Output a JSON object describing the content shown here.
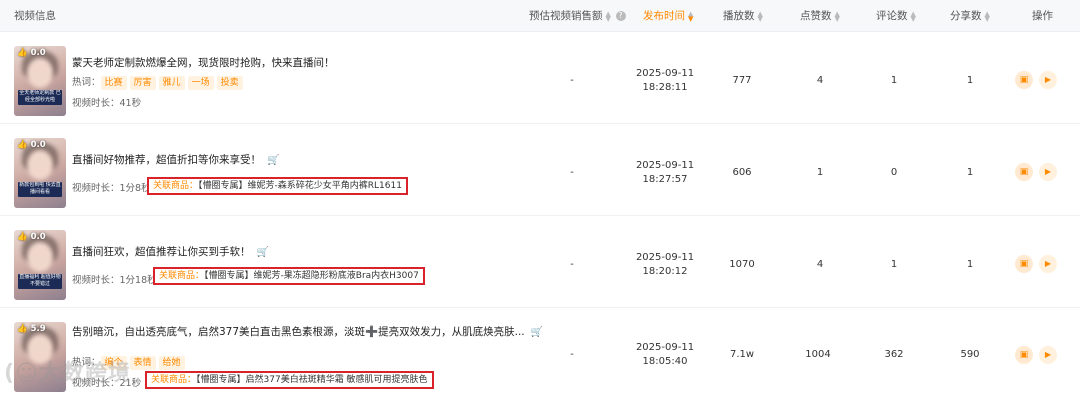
{
  "header": {
    "video_info": "视频信息",
    "est_sales": "预估视频销售额",
    "publish_time": "发布时间",
    "plays": "播放数",
    "likes": "点赞数",
    "comments": "评论数",
    "shares": "分享数",
    "actions": "操作"
  },
  "labels": {
    "hot_words": "热词：",
    "duration": "视频时长：",
    "related_product": "关联商品："
  },
  "rows": [
    {
      "score": "0.0",
      "thumb_caption": "全天老师定制款 已经全部秒光啦",
      "title": "蒙天老师定制款燃爆全网，现货限时抢购，快来直播间！",
      "tags": [
        "比赛",
        "厉害",
        "雅儿",
        "一场",
        "投卖"
      ],
      "duration": "41秒",
      "product": "",
      "est_sales": "-",
      "date": "2025-09-11",
      "time": "18:28:11",
      "plays": "777",
      "likes": "4",
      "comments": "1",
      "shares": "1"
    },
    {
      "score": "0.0",
      "thumb_caption": "新款包到啦 快去直播间看看",
      "title": "直播间好物推荐，超值折扣等你来享受！",
      "tags": [],
      "duration": "1分8秒",
      "product": "【懵圈专属】维妮芳-森系碎花少女平角内裤RL1611",
      "est_sales": "-",
      "date": "2025-09-11",
      "time": "18:27:57",
      "plays": "606",
      "likes": "1",
      "comments": "0",
      "shares": "1"
    },
    {
      "score": "0.0",
      "thumb_caption": "直播福利 超值好物不要错过",
      "title": "直播间狂欢，超值推荐让你买到手软！",
      "tags": [],
      "duration": "1分18秒",
      "product": "【懵圈专属】维妮芳-果冻超隐形粉底液Bra内衣H3007",
      "est_sales": "-",
      "date": "2025-09-11",
      "time": "18:20:12",
      "plays": "1070",
      "likes": "4",
      "comments": "1",
      "shares": "1"
    },
    {
      "score": "5.9",
      "thumb_caption": "",
      "title": "告别暗沉，自出透亮底气，启然377美白直击黑色素根源，淡斑➕提亮双效发力，从肌底焕亮肤...",
      "tags": [
        "编个",
        "表情",
        "给她"
      ],
      "duration": "21秒",
      "product": "【懵圈专属】启然377美白祛斑精华霜 敏感肌可用提亮肤色",
      "est_sales": "-",
      "date": "2025-09-11",
      "time": "18:05:40",
      "plays": "7.1w",
      "likes": "1004",
      "comments": "362",
      "shares": "590"
    }
  ],
  "icons": {
    "thumb_up": "thumb-up-icon",
    "cart": "cart-icon",
    "video": "video-icon",
    "play": "play-icon",
    "sort": "sort-icon",
    "help": "help-icon"
  },
  "colors": {
    "accent": "#ff8a00",
    "highlight_box": "#d9222a",
    "tag_bg": "#fff2e0"
  },
  "watermark": "(☺大数跨境"
}
